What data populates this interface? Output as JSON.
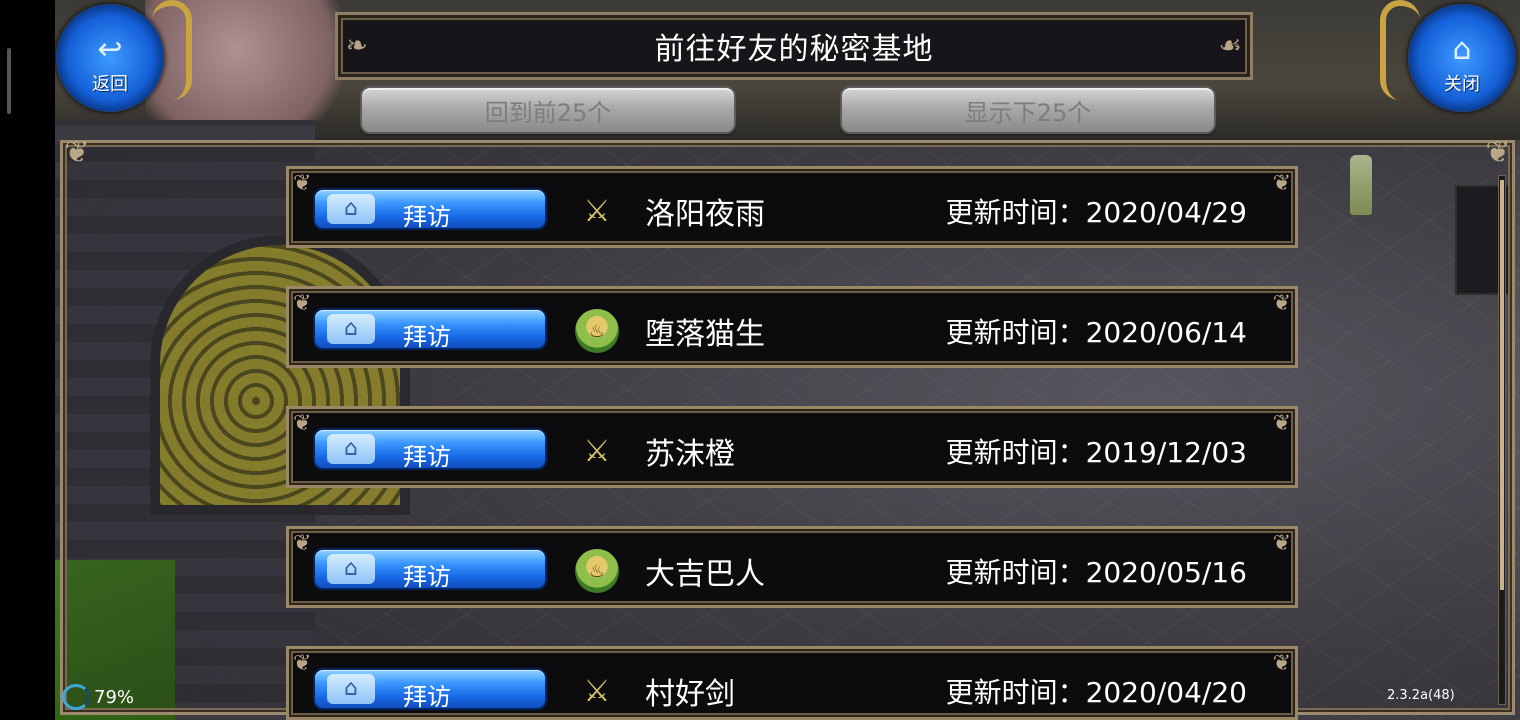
{
  "header": {
    "title": "前往好友的秘密基地",
    "prev_label": "回到前25个",
    "next_label": "显示下25个"
  },
  "back_button": {
    "icon": "back-arrow-icon",
    "label": "返回"
  },
  "close_button": {
    "icon": "home-icon",
    "label": "关闭"
  },
  "visit_label": "拜访",
  "friends": [
    {
      "icon": "sword-shield-icon",
      "name": "洛阳夜雨",
      "updated": "更新时间：2020/04/29"
    },
    {
      "icon": "kettle-icon",
      "name": "堕落猫生",
      "updated": "更新时间：2020/06/14"
    },
    {
      "icon": "sword-shield-icon",
      "name": "苏沫橙",
      "updated": "更新时间：2019/12/03"
    },
    {
      "icon": "kettle-icon",
      "name": "大吉巴人",
      "updated": "更新时间：2020/05/16"
    },
    {
      "icon": "sword-shield-icon",
      "name": "村好剑",
      "updated": "更新时间：2020/04/20"
    }
  ],
  "status": {
    "battery": "79%",
    "version": "2.3.2a(48)"
  },
  "colors": {
    "visit_button": "#1a68e6",
    "frame": "#9a8868",
    "page_button": "#a9a9a9"
  }
}
